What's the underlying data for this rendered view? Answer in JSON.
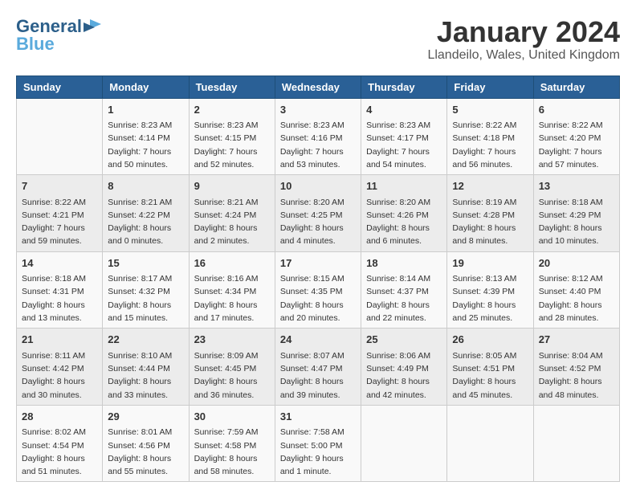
{
  "logo": {
    "line1": "General",
    "line2": "Blue"
  },
  "title": "January 2024",
  "location": "Llandeilo, Wales, United Kingdom",
  "days_of_week": [
    "Sunday",
    "Monday",
    "Tuesday",
    "Wednesday",
    "Thursday",
    "Friday",
    "Saturday"
  ],
  "weeks": [
    [
      {
        "day": "",
        "info": ""
      },
      {
        "day": "1",
        "info": "Sunrise: 8:23 AM\nSunset: 4:14 PM\nDaylight: 7 hours\nand 50 minutes."
      },
      {
        "day": "2",
        "info": "Sunrise: 8:23 AM\nSunset: 4:15 PM\nDaylight: 7 hours\nand 52 minutes."
      },
      {
        "day": "3",
        "info": "Sunrise: 8:23 AM\nSunset: 4:16 PM\nDaylight: 7 hours\nand 53 minutes."
      },
      {
        "day": "4",
        "info": "Sunrise: 8:23 AM\nSunset: 4:17 PM\nDaylight: 7 hours\nand 54 minutes."
      },
      {
        "day": "5",
        "info": "Sunrise: 8:22 AM\nSunset: 4:18 PM\nDaylight: 7 hours\nand 56 minutes."
      },
      {
        "day": "6",
        "info": "Sunrise: 8:22 AM\nSunset: 4:20 PM\nDaylight: 7 hours\nand 57 minutes."
      }
    ],
    [
      {
        "day": "7",
        "info": "Sunrise: 8:22 AM\nSunset: 4:21 PM\nDaylight: 7 hours\nand 59 minutes."
      },
      {
        "day": "8",
        "info": "Sunrise: 8:21 AM\nSunset: 4:22 PM\nDaylight: 8 hours\nand 0 minutes."
      },
      {
        "day": "9",
        "info": "Sunrise: 8:21 AM\nSunset: 4:24 PM\nDaylight: 8 hours\nand 2 minutes."
      },
      {
        "day": "10",
        "info": "Sunrise: 8:20 AM\nSunset: 4:25 PM\nDaylight: 8 hours\nand 4 minutes."
      },
      {
        "day": "11",
        "info": "Sunrise: 8:20 AM\nSunset: 4:26 PM\nDaylight: 8 hours\nand 6 minutes."
      },
      {
        "day": "12",
        "info": "Sunrise: 8:19 AM\nSunset: 4:28 PM\nDaylight: 8 hours\nand 8 minutes."
      },
      {
        "day": "13",
        "info": "Sunrise: 8:18 AM\nSunset: 4:29 PM\nDaylight: 8 hours\nand 10 minutes."
      }
    ],
    [
      {
        "day": "14",
        "info": "Sunrise: 8:18 AM\nSunset: 4:31 PM\nDaylight: 8 hours\nand 13 minutes."
      },
      {
        "day": "15",
        "info": "Sunrise: 8:17 AM\nSunset: 4:32 PM\nDaylight: 8 hours\nand 15 minutes."
      },
      {
        "day": "16",
        "info": "Sunrise: 8:16 AM\nSunset: 4:34 PM\nDaylight: 8 hours\nand 17 minutes."
      },
      {
        "day": "17",
        "info": "Sunrise: 8:15 AM\nSunset: 4:35 PM\nDaylight: 8 hours\nand 20 minutes."
      },
      {
        "day": "18",
        "info": "Sunrise: 8:14 AM\nSunset: 4:37 PM\nDaylight: 8 hours\nand 22 minutes."
      },
      {
        "day": "19",
        "info": "Sunrise: 8:13 AM\nSunset: 4:39 PM\nDaylight: 8 hours\nand 25 minutes."
      },
      {
        "day": "20",
        "info": "Sunrise: 8:12 AM\nSunset: 4:40 PM\nDaylight: 8 hours\nand 28 minutes."
      }
    ],
    [
      {
        "day": "21",
        "info": "Sunrise: 8:11 AM\nSunset: 4:42 PM\nDaylight: 8 hours\nand 30 minutes."
      },
      {
        "day": "22",
        "info": "Sunrise: 8:10 AM\nSunset: 4:44 PM\nDaylight: 8 hours\nand 33 minutes."
      },
      {
        "day": "23",
        "info": "Sunrise: 8:09 AM\nSunset: 4:45 PM\nDaylight: 8 hours\nand 36 minutes."
      },
      {
        "day": "24",
        "info": "Sunrise: 8:07 AM\nSunset: 4:47 PM\nDaylight: 8 hours\nand 39 minutes."
      },
      {
        "day": "25",
        "info": "Sunrise: 8:06 AM\nSunset: 4:49 PM\nDaylight: 8 hours\nand 42 minutes."
      },
      {
        "day": "26",
        "info": "Sunrise: 8:05 AM\nSunset: 4:51 PM\nDaylight: 8 hours\nand 45 minutes."
      },
      {
        "day": "27",
        "info": "Sunrise: 8:04 AM\nSunset: 4:52 PM\nDaylight: 8 hours\nand 48 minutes."
      }
    ],
    [
      {
        "day": "28",
        "info": "Sunrise: 8:02 AM\nSunset: 4:54 PM\nDaylight: 8 hours\nand 51 minutes."
      },
      {
        "day": "29",
        "info": "Sunrise: 8:01 AM\nSunset: 4:56 PM\nDaylight: 8 hours\nand 55 minutes."
      },
      {
        "day": "30",
        "info": "Sunrise: 7:59 AM\nSunset: 4:58 PM\nDaylight: 8 hours\nand 58 minutes."
      },
      {
        "day": "31",
        "info": "Sunrise: 7:58 AM\nSunset: 5:00 PM\nDaylight: 9 hours\nand 1 minute."
      },
      {
        "day": "",
        "info": ""
      },
      {
        "day": "",
        "info": ""
      },
      {
        "day": "",
        "info": ""
      }
    ]
  ]
}
